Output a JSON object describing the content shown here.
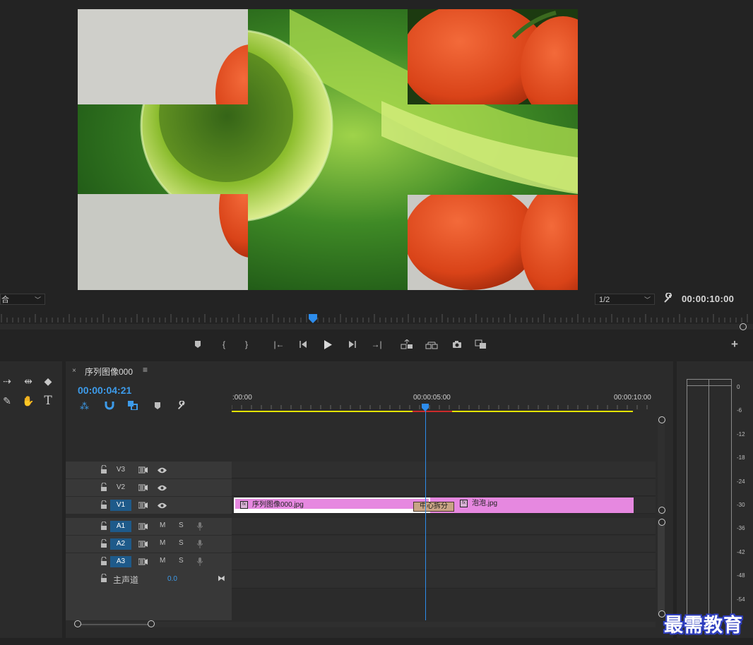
{
  "monitor": {
    "fit_dropdown": "合",
    "resolution_dropdown": "1/2",
    "duration_timecode": "00:00:10:00"
  },
  "sequence": {
    "tab_name": "序列图像000",
    "current_timecode": "00:00:04:21",
    "ruler_labels": [
      ":00:00",
      "00:00:05:00",
      "00:00:10:00"
    ]
  },
  "tracks": {
    "video": [
      "V3",
      "V2",
      "V1"
    ],
    "audio": [
      "A1",
      "A2",
      "A3"
    ],
    "mute_label": "M",
    "solo_label": "S",
    "master": {
      "label": "主声道",
      "value": "0.0"
    }
  },
  "clips": {
    "clip1": "序列图像000.jpg",
    "transition": "中心拆分",
    "clip2": "泡泡.jpg",
    "fx_label": "fx"
  },
  "meter_db": [
    "0",
    "-6",
    "-12",
    "-18",
    "-24",
    "-30",
    "-36",
    "-42",
    "-48",
    "-54"
  ],
  "watermark": "最需教育",
  "colors": {
    "accent": "#2d8ceb",
    "clip": "#e688e0",
    "selected_track": "#1e5a8a",
    "work_area": "#e4e400"
  }
}
